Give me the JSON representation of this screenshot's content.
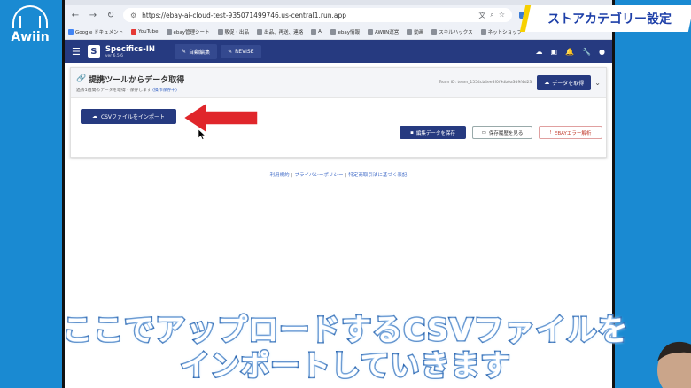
{
  "overlay": {
    "logo_text": "Awiin",
    "topic_title": "ストアカテゴリー設定",
    "subtitle_line1": "ここでアップロードするCSVファイルを",
    "subtitle_line2": "インポートしていきます"
  },
  "browser": {
    "url": "https://ebay-ai-cloud-test-935071499746.us-central1.run.app",
    "bookmarks": [
      "Google ドキュメント",
      "YouTube",
      "ebay管理シート",
      "販促・出品",
      "出品、再送、連絡",
      "AI",
      "ebay情報",
      "AWIIN運営",
      "動画",
      "スキルハックス",
      "ネットショップ"
    ]
  },
  "app": {
    "name": "Specifics-IN",
    "version": "ver 6.5.6",
    "tabs": [
      "自動編集",
      "REVISE"
    ],
    "card": {
      "title": "提携ツールからデータ取得",
      "subtitle": "過去1週間のデータを取得・保存します",
      "subtitle_link": "(操作保存中)",
      "team_id": "Team ID: team_1554cb4ee8f0f9db0a3d9f4d23",
      "fetch_label": "データを取得"
    },
    "import_label": "CSVファイルをインポート",
    "save_label": "編集データを保存",
    "history_label": "保存履歴を見る",
    "error_label": "EBAYエラー解析",
    "footer": [
      "利用規約",
      "プライバシーポリシー",
      "特定商取引法に基づく表記"
    ]
  },
  "colors": {
    "brand": "#263a80",
    "accent_red": "#e0262b",
    "background": "#1d8fd6"
  }
}
